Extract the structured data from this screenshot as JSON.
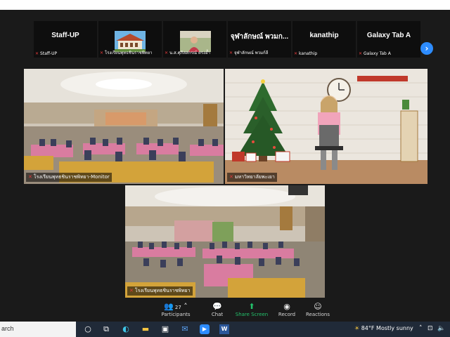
{
  "thumbnails": [
    {
      "name": "Staff-UP",
      "label": "Staff-UP",
      "type": "name"
    },
    {
      "name": "",
      "label": "โรงเรียนพุทธชินราชพิทยา",
      "type": "image",
      "image": "building"
    },
    {
      "name": "",
      "label": "น.ส.ศุภิสสกรณ์ ตรงอ้ำ",
      "type": "image",
      "image": "person"
    },
    {
      "name": "จุฬาลักษณ์ พวมก...",
      "label": "จุฬาลักษณ์ พวมก์ลี",
      "type": "name"
    },
    {
      "name": "kanathip",
      "label": "kanathip",
      "type": "name"
    },
    {
      "name": "Galaxy Tab A",
      "label": "Galaxy Tab A",
      "type": "name"
    }
  ],
  "next_icon": "chevron-right-icon",
  "tiles": {
    "monitor": {
      "label": "โรงเรียนพุทธชินราชพิทยา-Monitor"
    },
    "speaker": {
      "label": "มหาวิทยาลัยพะเยา",
      "active": true
    },
    "hall": {
      "label": "โรงเรียนพุทธชินราชพิทยา"
    }
  },
  "controls": {
    "participants": {
      "label": "Participants",
      "count": "27",
      "icon": "participants-icon"
    },
    "chat": {
      "label": "Chat",
      "icon": "chat-icon"
    },
    "share": {
      "label": "Share Screen",
      "icon": "share-screen-icon"
    },
    "record": {
      "label": "Record",
      "icon": "record-icon"
    },
    "reactions": {
      "label": "Reactions",
      "icon": "reactions-icon"
    }
  },
  "taskbar": {
    "search_text": "arch",
    "weather": "84°F  Mostly sunny",
    "apps": [
      "cortana-icon",
      "task-view-icon",
      "edge-icon",
      "file-explorer-icon",
      "store-icon",
      "mail-icon",
      "zoom-icon",
      "word-icon"
    ]
  },
  "colors": {
    "zoom_bg": "#1a1a1a",
    "active_speaker": "#d8e53b",
    "share_green": "#23c16b",
    "muted_red": "#e03a3a",
    "zoom_blue": "#2d8cff"
  }
}
